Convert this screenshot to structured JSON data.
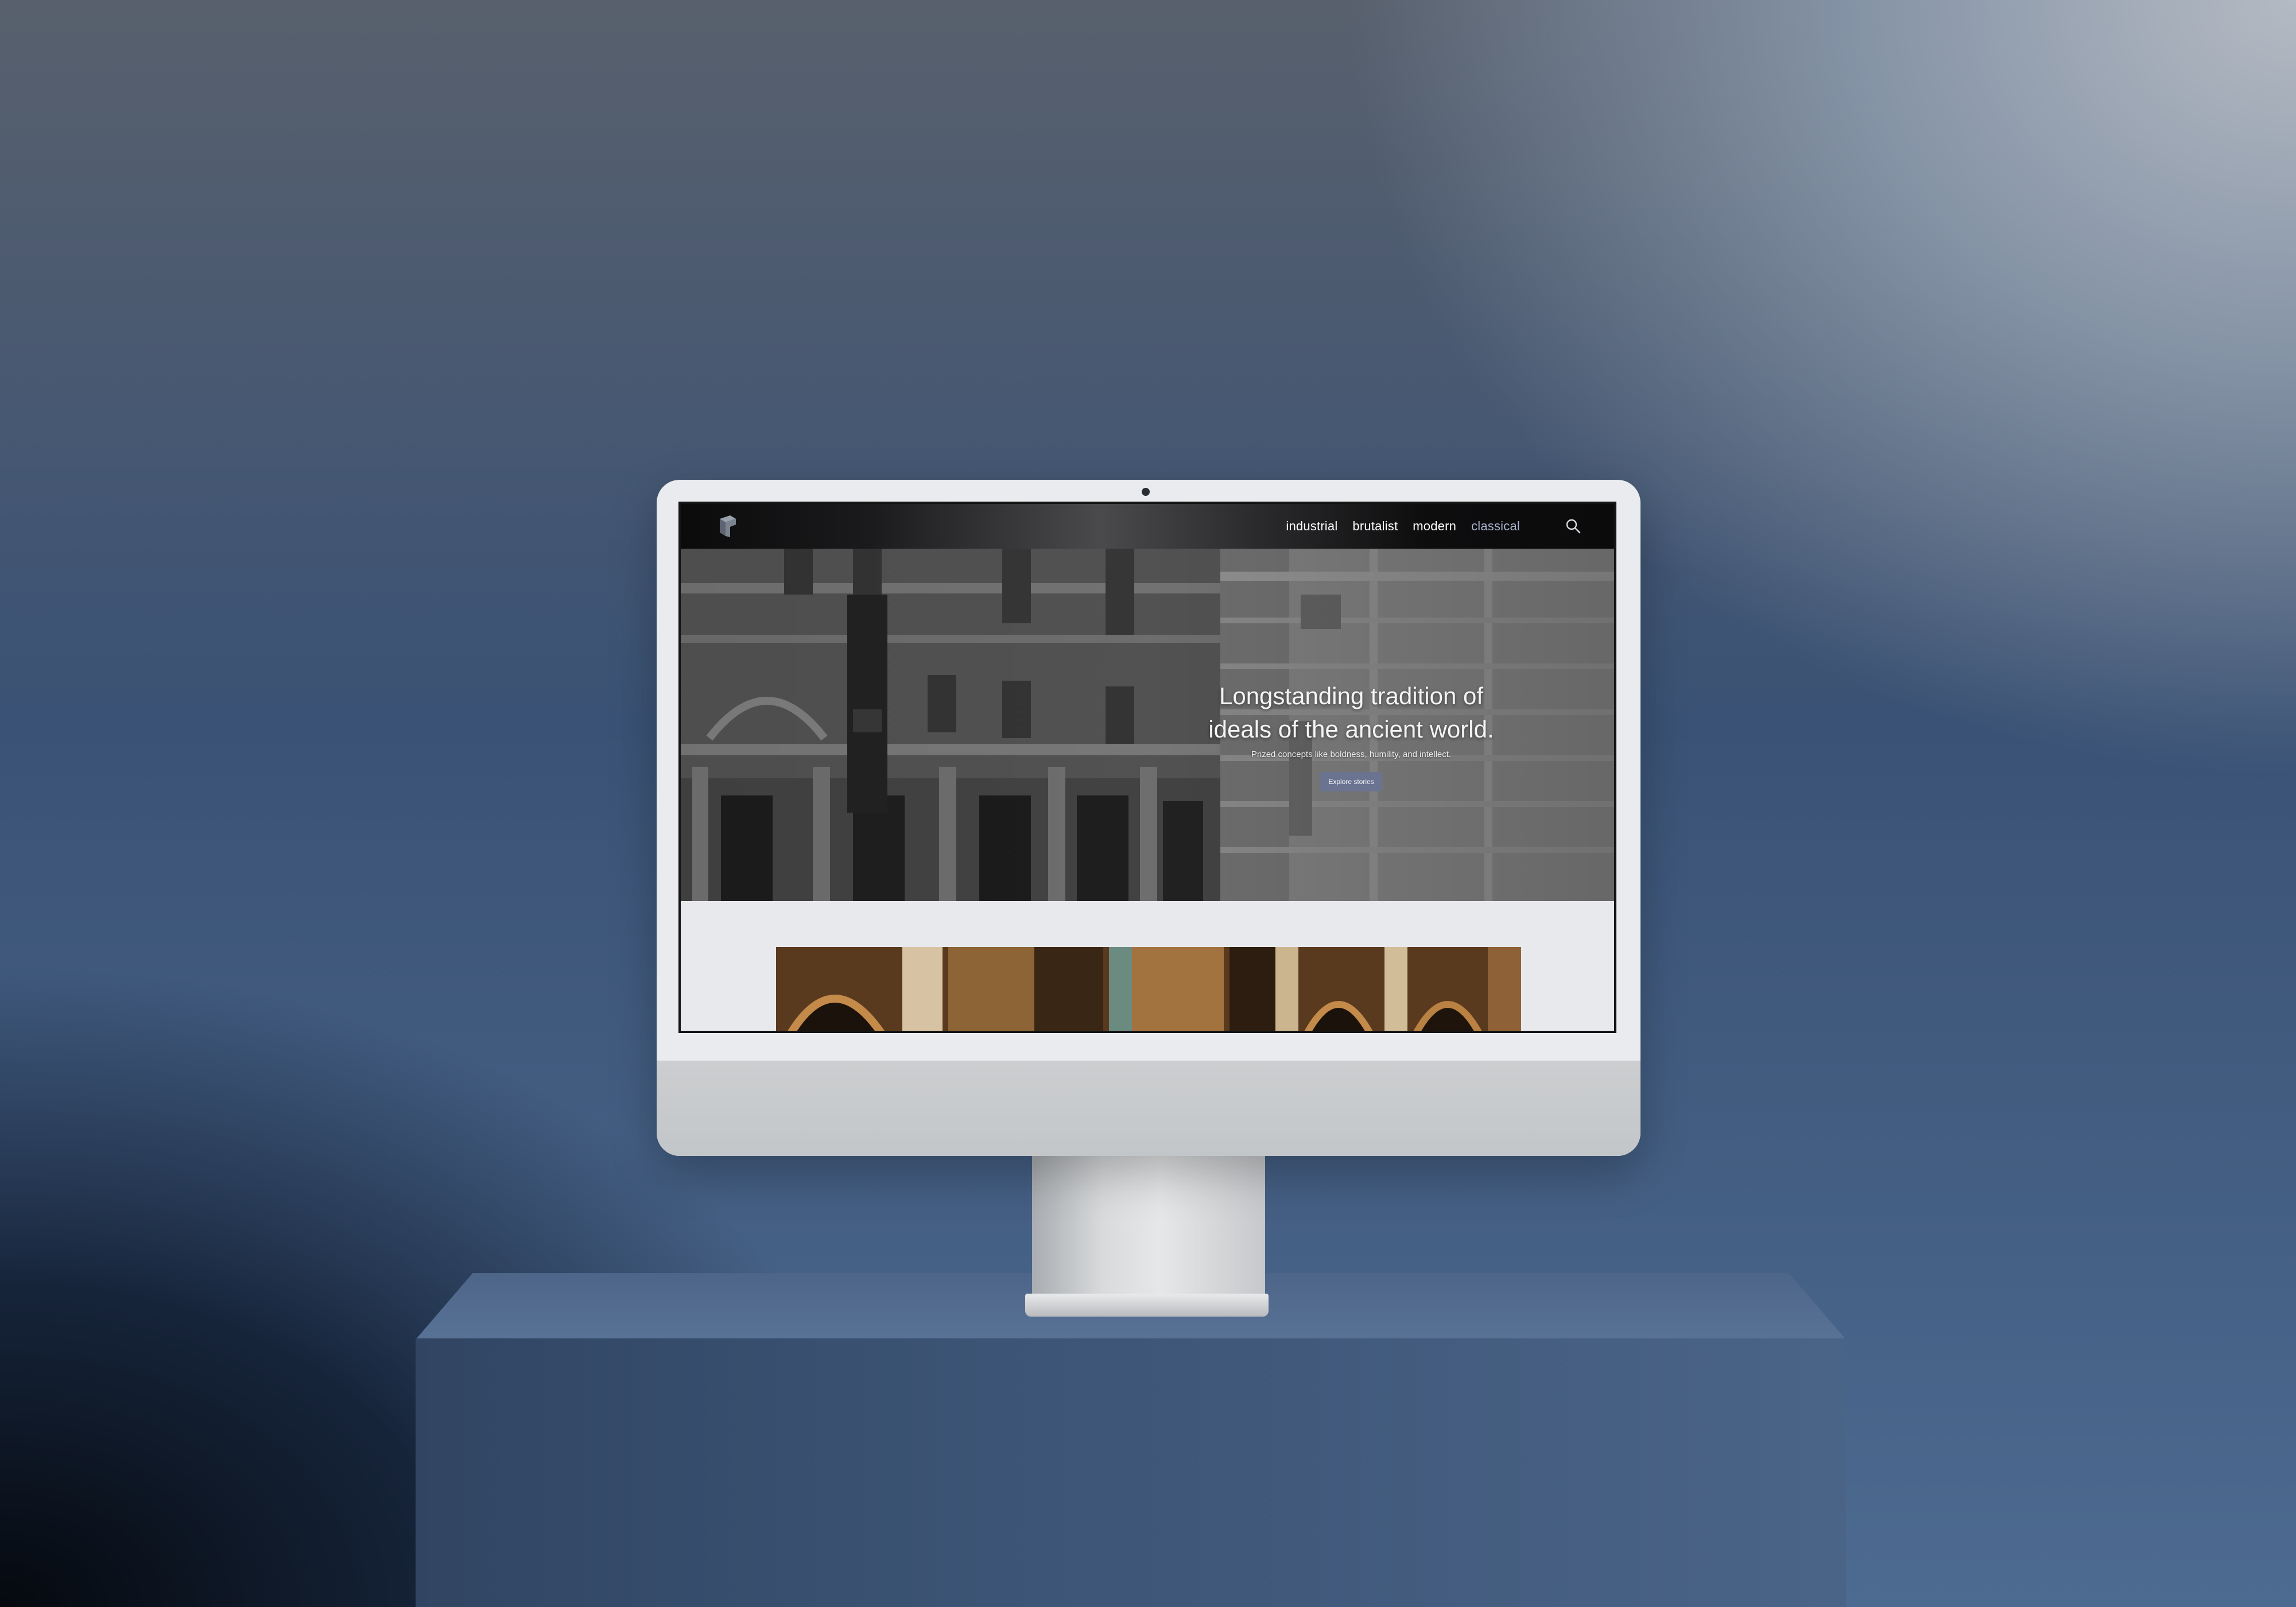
{
  "site": {
    "nav": {
      "links": [
        {
          "label": "industrial",
          "active": false
        },
        {
          "label": "brutalist",
          "active": false
        },
        {
          "label": "modern",
          "active": false
        },
        {
          "label": "classical",
          "active": true
        }
      ],
      "search_icon": "search-icon",
      "active_color": "#a8b4cf"
    },
    "hero": {
      "title_line1": "Longstanding tradition of",
      "title_line2": "ideals of the ancient world.",
      "subtitle": "Prized concepts like boldness, humility, and intellect.",
      "cta_label": "Explore stories",
      "cta_color": "#6a7490"
    }
  }
}
